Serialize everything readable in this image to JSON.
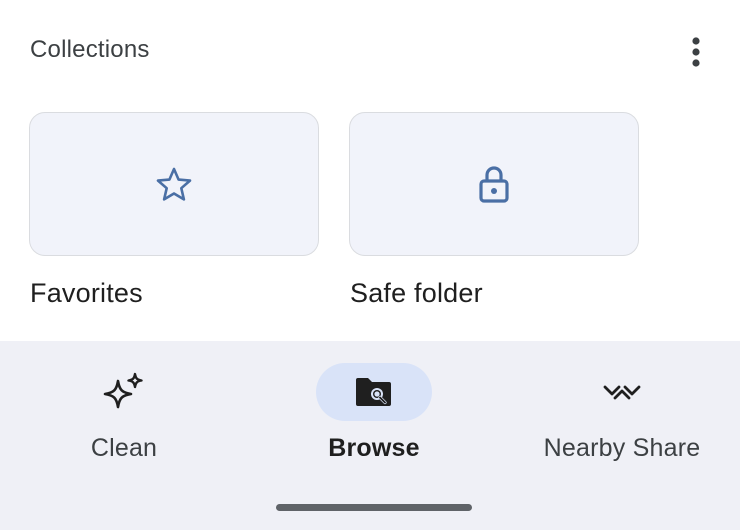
{
  "header": {
    "title": "Collections",
    "menu_icon": "more-vert-icon"
  },
  "collections": [
    {
      "label": "Favorites",
      "icon": "star-outline-icon"
    },
    {
      "label": "Safe folder",
      "icon": "lock-icon"
    }
  ],
  "bottom_nav": {
    "selected": "Browse",
    "items": [
      {
        "label": "Clean",
        "icon": "sparkle-icon"
      },
      {
        "label": "Browse",
        "icon": "folder-search-icon"
      },
      {
        "label": "Nearby Share",
        "icon": "nearby-share-icon"
      }
    ]
  },
  "colors": {
    "tile_background": "#f1f3fa",
    "tile_icon": "#4a6fa5",
    "nav_background": "#eff0f6",
    "nav_selected_pill": "#d9e3f8",
    "nav_icon": "#1f1f1f"
  }
}
